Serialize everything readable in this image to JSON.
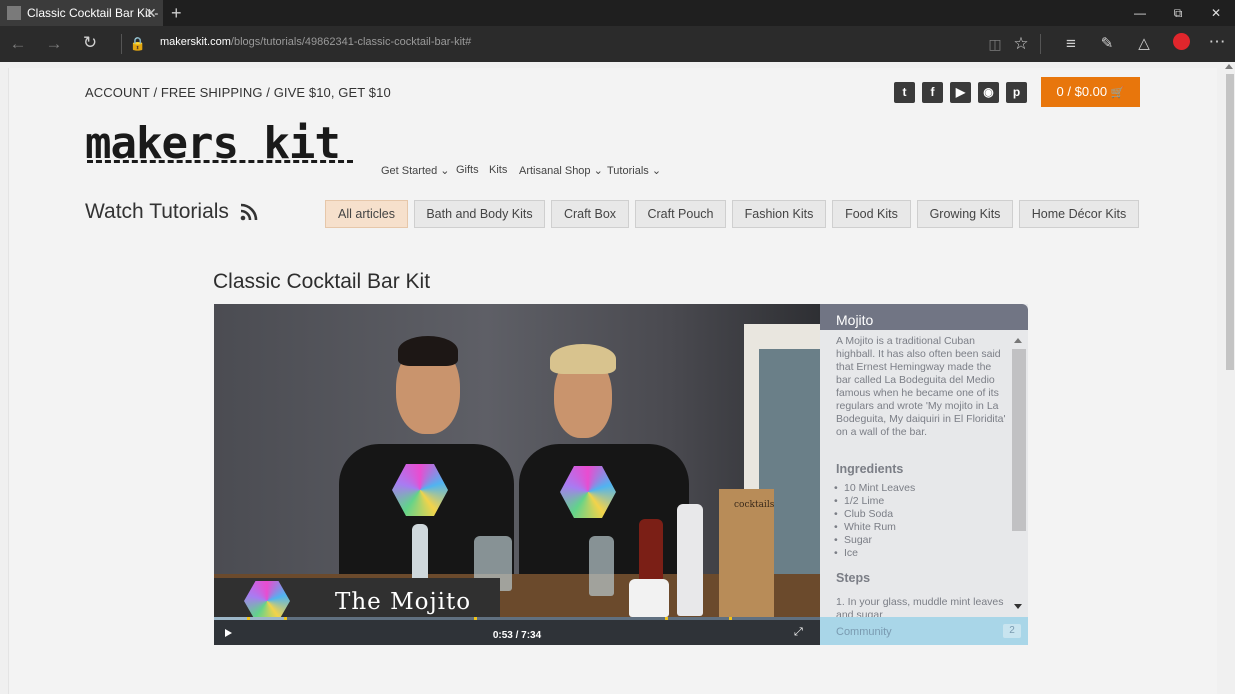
{
  "browser": {
    "tab_title": "Classic Cocktail Bar Kit -",
    "tab_close": "✕",
    "new_tab": "+",
    "url_host": "makerskit.com",
    "url_path": "/blogs/tutorials/49862341-classic-cocktail-bar-kit#"
  },
  "header": {
    "topbar_text": "ACCOUNT / FREE SHIPPING / GIVE $10, GET $10",
    "social": [
      "twitter-icon",
      "facebook-icon",
      "youtube-icon",
      "instagram-icon",
      "pinterest-icon"
    ],
    "cart_label": "0 / $0.00",
    "logo_text": "makers kit",
    "nav": [
      "Get Started ⌄",
      "Gifts",
      "Kits",
      "Artisanal Shop ⌄",
      "Tutorials ⌄"
    ]
  },
  "tutorials": {
    "title": "Watch Tutorials",
    "categories": [
      "All articles",
      "Bath and Body Kits",
      "Craft Box",
      "Craft Pouch",
      "Fashion Kits",
      "Food Kits",
      "Growing Kits",
      "Home Décor Kits"
    ],
    "active_category": "All articles"
  },
  "article": {
    "title": "Classic Cocktail Bar Kit"
  },
  "video": {
    "overlay_title": "The Mojito",
    "box_label": "cocktails",
    "time": "0:53 / 7:34",
    "progress": 0.117
  },
  "panel": {
    "title": "Mojito",
    "description": "A Mojito is a traditional Cuban highball. It has also often been said that Ernest Hemingway made the bar called La Bodeguita del Medio famous when he became one of its regulars and wrote 'My mojito in La Bodeguita, My daiquiri in El Floridita' on a wall of the bar.",
    "ingredients_heading": "Ingredients",
    "ingredients": [
      "10 Mint Leaves",
      "1/2 Lime",
      "Club Soda",
      "White Rum",
      "Sugar",
      "Ice"
    ],
    "steps_heading": "Steps",
    "steps_first": "1. In your glass, muddle mint leaves and sugar",
    "community_label": "Community",
    "community_count": "2"
  },
  "colors": {
    "accent": "#e8760c",
    "active_category": "#f6e0cc",
    "panel_header": "#717584",
    "community": "#a9d6e8"
  }
}
